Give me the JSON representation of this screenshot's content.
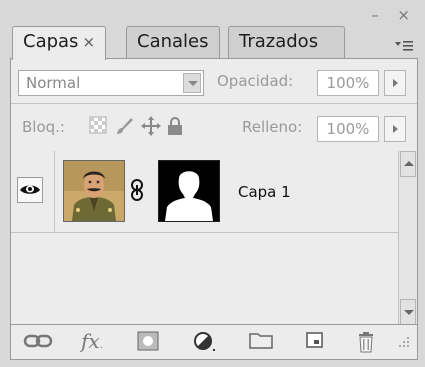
{
  "window": {
    "controls": {
      "minimize": "–",
      "close": "×"
    }
  },
  "tabs": [
    {
      "label": "Capas",
      "close": "×",
      "active": true
    },
    {
      "label": "Canales"
    },
    {
      "label": "Trazados"
    }
  ],
  "panel_menu_icon": "panel-menu-icon",
  "blend": {
    "value": "Normal"
  },
  "opacity": {
    "label": "Opacidad:",
    "value": "100%"
  },
  "lock": {
    "label": "Bloq.:",
    "icons": [
      "lock-transparency-icon",
      "lock-image-icon",
      "lock-position-icon",
      "lock-all-icon"
    ]
  },
  "fill": {
    "label": "Relleno:",
    "value": "100%"
  },
  "layers": [
    {
      "name": "Capa 1",
      "visible": true,
      "thumbnail": "portrait-thumbnail",
      "mask": "silhouette-mask-thumbnail"
    }
  ],
  "toolbar": {
    "fx_label": "fx",
    "icons": [
      "link-layers-icon",
      "layer-style-icon",
      "add-mask-icon",
      "adjustment-layer-icon",
      "new-group-icon",
      "new-layer-icon",
      "delete-layer-icon"
    ]
  },
  "colors": {
    "panel_bg": "#ececec",
    "chrome_bg": "#d8d8d8",
    "border": "#9a9a9a"
  }
}
